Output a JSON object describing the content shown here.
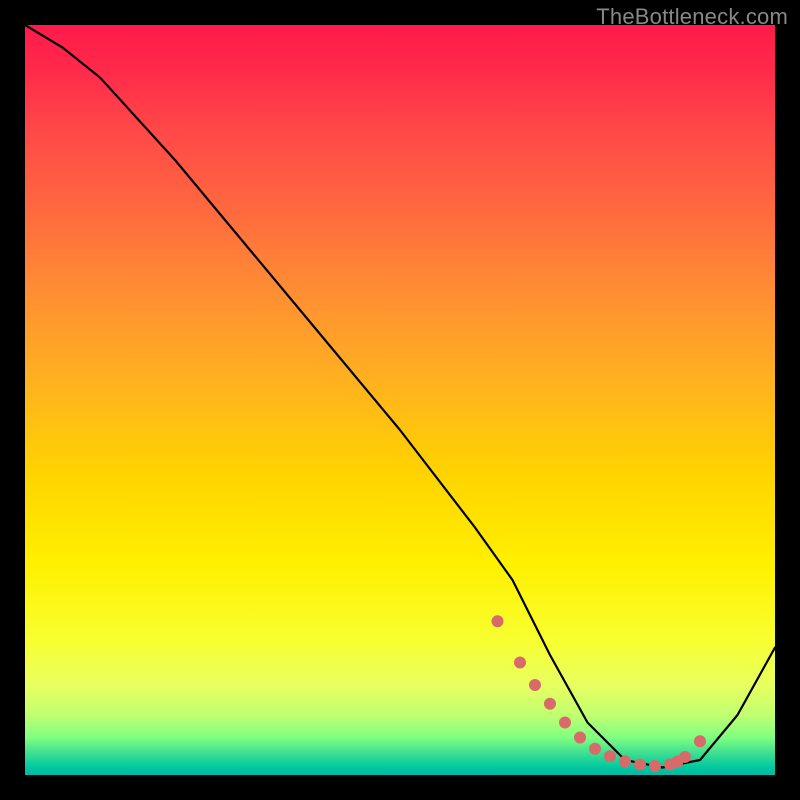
{
  "watermark": "TheBottleneck.com",
  "chart_data": {
    "type": "line",
    "title": "",
    "xlabel": "",
    "ylabel": "",
    "xlim": [
      0,
      100
    ],
    "ylim": [
      0,
      100
    ],
    "series": [
      {
        "name": "curve",
        "x": [
          0,
          5,
          10,
          20,
          30,
          40,
          50,
          60,
          65,
          70,
          75,
          80,
          85,
          90,
          95,
          100
        ],
        "values": [
          100,
          97,
          93,
          82,
          70,
          58,
          46,
          33,
          26,
          16,
          7,
          2,
          1,
          2,
          8,
          17
        ]
      }
    ],
    "markers": {
      "name": "highlight-points",
      "x": [
        63,
        66,
        68,
        70,
        72,
        74,
        76,
        78,
        80,
        82,
        84,
        86,
        87,
        88,
        90
      ],
      "values": [
        20.5,
        15,
        12,
        9.5,
        7,
        5,
        3.5,
        2.5,
        1.8,
        1.4,
        1.2,
        1.4,
        1.8,
        2.4,
        4.5
      ],
      "color": "#d86a6a",
      "radius": 6
    },
    "colors": {
      "line": "#000000",
      "marker": "#d86a6a"
    }
  }
}
